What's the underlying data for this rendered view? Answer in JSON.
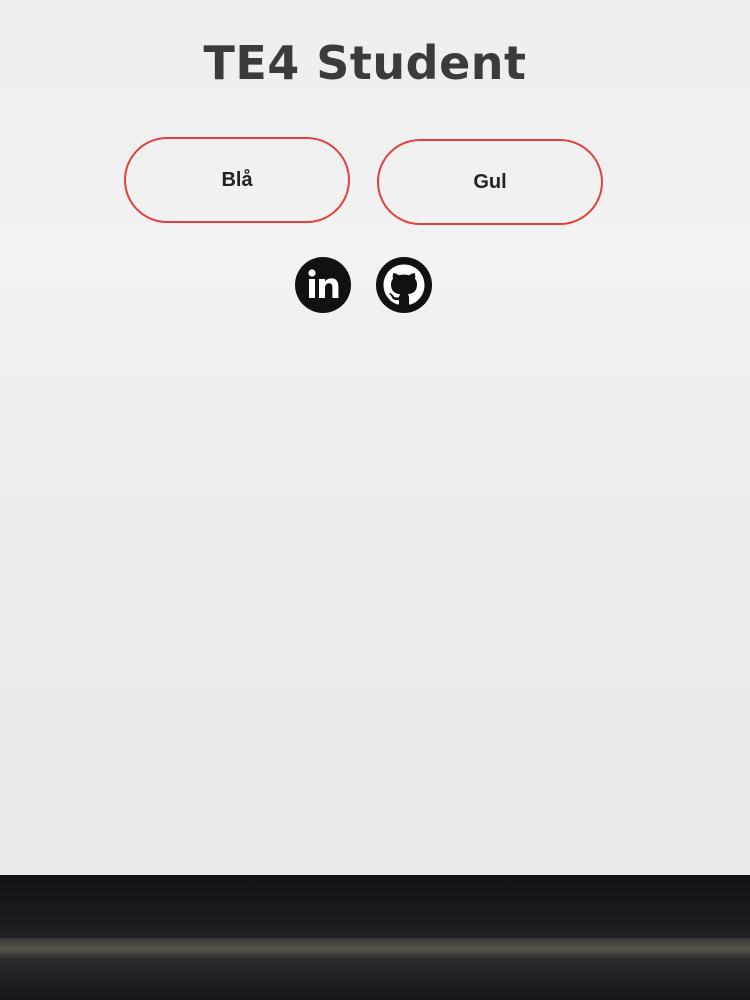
{
  "page": {
    "title": "TE4 Student"
  },
  "buttons": {
    "bla_label": "Blå",
    "gul_label": "Gul",
    "border_color": "#e0413e"
  },
  "social": {
    "linkedin_icon": "linkedin-icon",
    "github_icon": "github-icon"
  }
}
